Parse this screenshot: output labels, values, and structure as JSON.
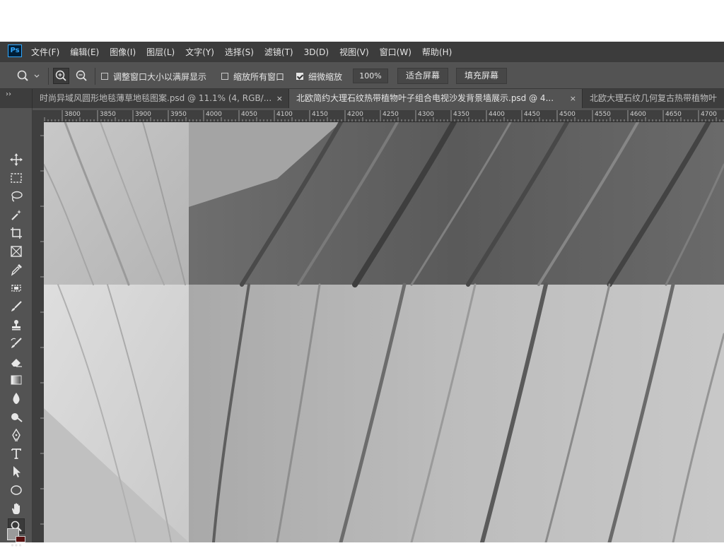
{
  "app": {
    "logo_text": "Ps"
  },
  "menu": {
    "items": [
      "文件(F)",
      "编辑(E)",
      "图像(I)",
      "图层(L)",
      "文字(Y)",
      "选择(S)",
      "滤镜(T)",
      "3D(D)",
      "视图(V)",
      "窗口(W)",
      "帮助(H)"
    ]
  },
  "options": {
    "resize_windows_label": "调整窗口大小以满屏显示",
    "resize_windows_checked": false,
    "zoom_all_windows_label": "缩放所有窗口",
    "zoom_all_windows_checked": false,
    "scrubby_zoom_label": "细微缩放",
    "scrubby_zoom_checked": true,
    "zoom_value": "100%",
    "fit_screen_label": "适合屏幕",
    "fill_screen_label": "填充屏幕"
  },
  "tabs": [
    {
      "title": "时尚异域风圆形地毯薄草地毯图案.psd @ 11.1% (4, RGB/...",
      "active": false
    },
    {
      "title": "北欧简约大理石纹热带植物叶子组合电视沙发背景墙展示.psd @ 4...",
      "active": true
    },
    {
      "title": "北欧大理石纹几何复古热带植物叶",
      "active": false
    }
  ],
  "tab_close_glyph": "×",
  "ruler": {
    "labels": [
      "3800",
      "3850",
      "3900",
      "3950",
      "4000",
      "4050",
      "4100",
      "4150",
      "4200",
      "4250",
      "4300",
      "4350",
      "4400",
      "4450",
      "4500",
      "4550",
      "4600",
      "4650",
      "4700"
    ]
  },
  "tools": [
    "move-tool",
    "marquee-tool",
    "lasso-tool",
    "magic-wand-tool",
    "crop-tool",
    "frame-tool",
    "eyedropper-tool",
    "healing-tool",
    "brush-tool",
    "stamp-tool",
    "history-brush-tool",
    "eraser-tool",
    "gradient-tool",
    "blur-tool",
    "dodge-tool",
    "pen-tool",
    "type-tool",
    "path-selection-tool",
    "shape-tool",
    "hand-tool",
    "zoom-tool",
    "more-tools"
  ],
  "colors": {
    "foreground": "#9a9a9a",
    "background": "#5a1010"
  }
}
